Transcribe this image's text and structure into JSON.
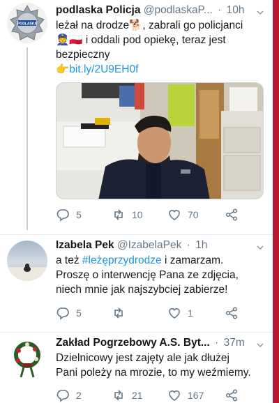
{
  "tweets": [
    {
      "name": "podlaska Policja",
      "handle": "@podlaskaP...",
      "time": "10h",
      "line1": "leżał na drodze🐕, zabrali go policjanci",
      "line2": "👮🇵🇱 i oddali pod opiekę, teraz jest",
      "line3": "bezpieczny",
      "link": "👉bit.ly/2U9EH0f",
      "avatar_text": "PODLASKA",
      "replies": "5",
      "retweets": "10",
      "likes": "70"
    },
    {
      "name": "Izabela Pek",
      "handle": "@IzabelaPek",
      "time": "1h",
      "line1_pre": "a też ",
      "line1_hash": "#leżęprzydrodze",
      "line1_post": " i zamarzam.",
      "line2": "Proszę o interwencję Pana ze zdjęcia,",
      "line3": "niech mnie jak najszybciej zabierze!",
      "replies": "5",
      "retweets": "",
      "likes": "1"
    },
    {
      "name": "Zakład Pogrzebowy A.S. Byt...",
      "handle": "",
      "time": "37m",
      "line1": "Dzielnicowy jest zajęty ale jak dłużej",
      "line2": "Pani poleży na mrozie, to my weźmiemy.",
      "replies": "2",
      "retweets": "21",
      "likes": "167"
    }
  ],
  "colors": {
    "link": "#1b95e0",
    "secondary_text": "#657786",
    "thread_line": "#c4cfd6",
    "accent_edge": "#b7192f"
  }
}
